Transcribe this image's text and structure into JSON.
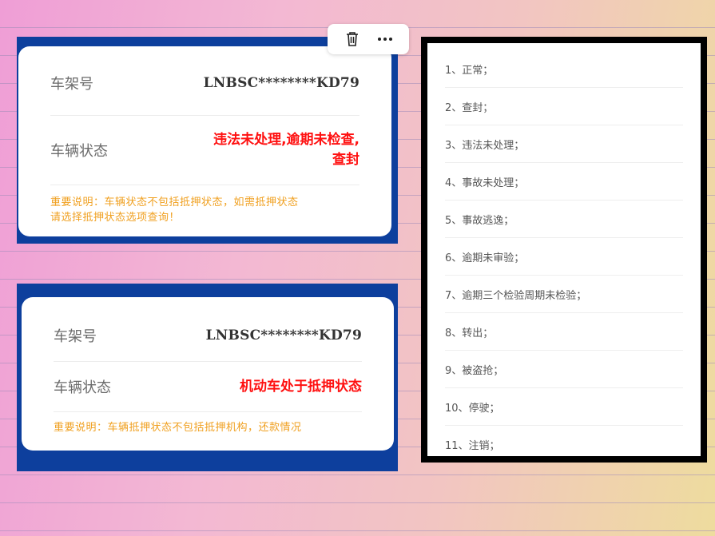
{
  "card1": {
    "vin_label": "车架号",
    "vin_value": "LNBSC********KD79",
    "status_label": "车辆状态",
    "status_line1": "违法未处理,逾期未检查,",
    "status_line2": "查封",
    "note_line1": "重要说明：车辆状态不包括抵押状态，如需抵押状态",
    "note_line2": "请选择抵押状态选项查询！"
  },
  "card2": {
    "vin_label": "车架号",
    "vin_value": "LNBSC********KD79",
    "status_label": "车辆状态",
    "status_value": "机动车处于抵押状态",
    "note": "重要说明：车辆抵押状态不包括抵押机构，还款情况"
  },
  "toolbar": {
    "icons": [
      "trash-icon",
      "more-icon"
    ]
  },
  "status_list": [
    "1、正常；",
    "2、查封；",
    "3、违法未处理；",
    "4、事故未处理；",
    "5、事故逃逸；",
    "6、逾期未审验；",
    "7、逾期三个检验周期未检验；",
    "8、转出；",
    "9、被盗抢；",
    "10、停驶；",
    "11、注销；"
  ],
  "colors": {
    "panel_blue": "#0d3f9d",
    "status_red": "#ff1010",
    "note_orange": "#f0a020",
    "list_border": "#000000"
  }
}
